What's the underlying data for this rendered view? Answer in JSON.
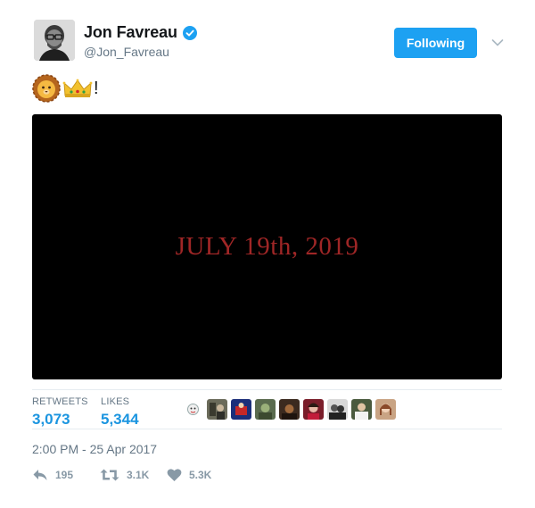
{
  "author": {
    "display_name": "Jon Favreau",
    "handle": "@Jon_Favreau",
    "verified": true
  },
  "follow_button": {
    "label": "Following"
  },
  "tweet": {
    "emojis": [
      "lion-emoji",
      "crown-emoji"
    ],
    "text_suffix": "!",
    "media_caption": "JULY 19th, 2019"
  },
  "stats": {
    "retweets_label": "RETWEETS",
    "retweets_value": "3,073",
    "likes_label": "LIKES",
    "likes_value": "5,344"
  },
  "likers": [
    "liker-avatar-1",
    "liker-avatar-2",
    "liker-avatar-3",
    "liker-avatar-4",
    "liker-avatar-5",
    "liker-avatar-6",
    "liker-avatar-7",
    "liker-avatar-8",
    "liker-avatar-9"
  ],
  "timestamp": "2:00 PM - 25 Apr 2017",
  "actions": {
    "reply_count": "195",
    "retweet_count": "3.1K",
    "like_count": "5.3K"
  },
  "colors": {
    "brand_blue": "#1da1f2",
    "link_blue": "#1b95e0",
    "muted_gray": "#657786",
    "caption_red": "#9f2626"
  }
}
